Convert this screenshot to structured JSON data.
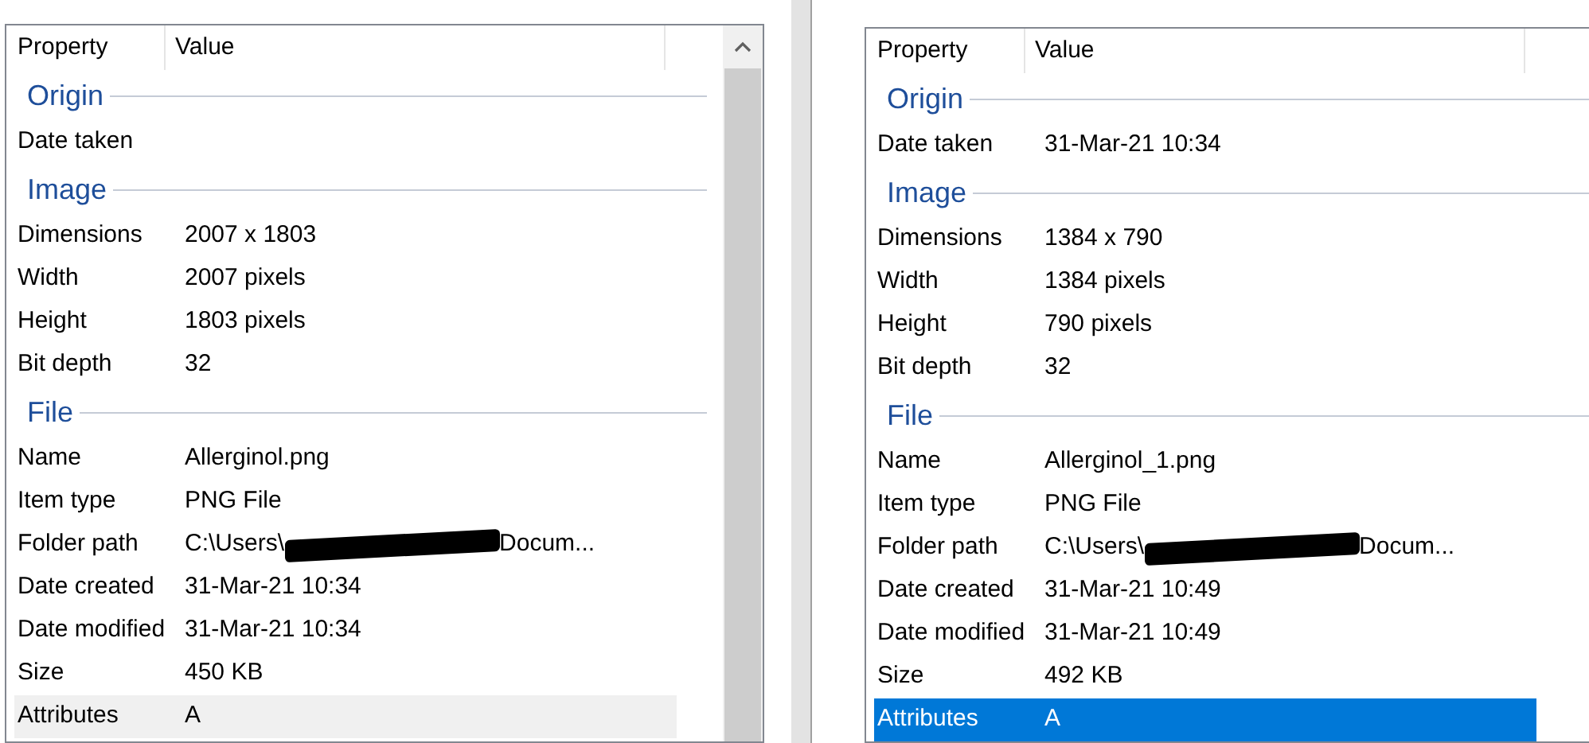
{
  "panels": [
    {
      "focused": false,
      "scrollbar": true,
      "columns": [
        "Property",
        "Value"
      ],
      "groups": [
        {
          "title": "Origin",
          "rows": [
            {
              "property": "Date taken",
              "selected": false
            }
          ]
        },
        {
          "title": "Image",
          "rows": [
            {
              "property": "Dimensions",
              "value": "2007 x 1803",
              "selected": false
            },
            {
              "property": "Width",
              "value": "2007 pixels",
              "selected": false
            },
            {
              "property": "Height",
              "value": "1803 pixels",
              "selected": false
            },
            {
              "property": "Bit depth",
              "value": "32",
              "selected": false
            }
          ]
        },
        {
          "title": "File",
          "rows": [
            {
              "property": "Name",
              "value": "Allerginol.png",
              "selected": false
            },
            {
              "property": "Item type",
              "value": "PNG File",
              "selected": false
            },
            {
              "property": "Folder path",
              "value": "C:\\Users\\",
              "redacted": true,
              "value_after": "Docum...",
              "selected": false
            },
            {
              "property": "Date created",
              "value": "31-Mar-21 10:34",
              "selected": false
            },
            {
              "property": "Date modified",
              "value": "31-Mar-21 10:34",
              "selected": false
            },
            {
              "property": "Size",
              "value": "450 KB",
              "selected": false
            },
            {
              "property": "Attributes",
              "value": "A",
              "selected": true
            }
          ]
        }
      ]
    },
    {
      "focused": true,
      "scrollbar": false,
      "columns": [
        "Property",
        "Value"
      ],
      "groups": [
        {
          "title": "Origin",
          "rows": [
            {
              "property": "Date taken",
              "value": "31-Mar-21 10:34",
              "selected": false
            }
          ]
        },
        {
          "title": "Image",
          "rows": [
            {
              "property": "Dimensions",
              "value": "1384 x 790",
              "selected": false
            },
            {
              "property": "Width",
              "value": "1384 pixels",
              "selected": false
            },
            {
              "property": "Height",
              "value": "790 pixels",
              "selected": false
            },
            {
              "property": "Bit depth",
              "value": "32",
              "selected": false
            }
          ]
        },
        {
          "title": "File",
          "rows": [
            {
              "property": "Name",
              "value": "Allerginol_1.png",
              "selected": false
            },
            {
              "property": "Item type",
              "value": "PNG File",
              "selected": false
            },
            {
              "property": "Folder path",
              "value": "C:\\Users\\",
              "redacted": true,
              "value_after": "Docum...",
              "selected": false
            },
            {
              "property": "Date created",
              "value": "31-Mar-21 10:49",
              "selected": false
            },
            {
              "property": "Date modified",
              "value": "31-Mar-21 10:49",
              "selected": false
            },
            {
              "property": "Size",
              "value": "492 KB",
              "selected": false
            },
            {
              "property": "Attributes",
              "value": "A",
              "selected": true
            }
          ]
        }
      ]
    }
  ]
}
